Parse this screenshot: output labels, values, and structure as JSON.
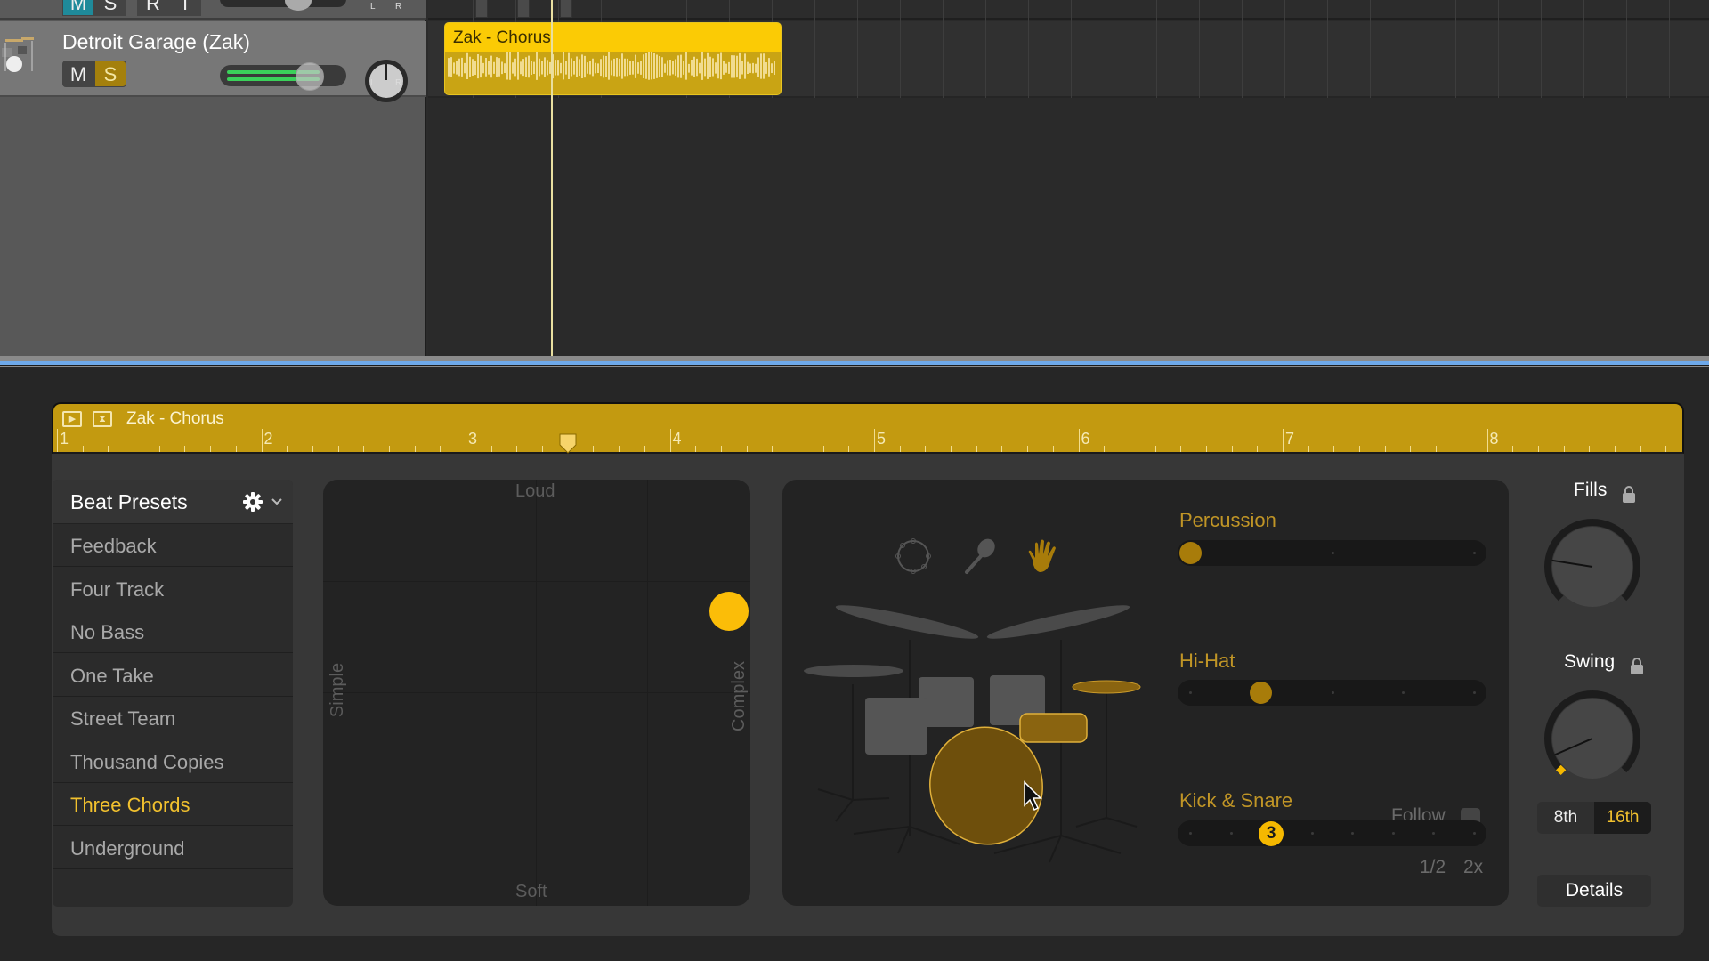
{
  "tracks": {
    "top_track": {
      "mute_label": "M",
      "solo_label": "S",
      "record_label": "R",
      "input_label": "I"
    },
    "track": {
      "name": "Detroit Garage (Zak)",
      "mute_label": "M",
      "solo_label": "S",
      "solo_active": true,
      "volume_fraction": 0.78,
      "pan_left_label": "L",
      "pan_right_label": "R"
    },
    "region": {
      "title": "Zak - Chorus",
      "color": "#fbcb05"
    }
  },
  "editor": {
    "region_title": "Zak - Chorus",
    "ruler_bars": [
      "1",
      "2",
      "3",
      "4",
      "5",
      "6",
      "7",
      "8"
    ],
    "playhead_bar": 3.5,
    "header_color": "#c39a10",
    "beat_presets": {
      "title": "Beat Presets",
      "settings_icon": "gear-icon",
      "items": [
        {
          "label": "Feedback",
          "selected": false
        },
        {
          "label": "Four Track",
          "selected": false
        },
        {
          "label": "No Bass",
          "selected": false
        },
        {
          "label": "One Take",
          "selected": false
        },
        {
          "label": "Street Team",
          "selected": false
        },
        {
          "label": "Thousand Copies",
          "selected": false
        },
        {
          "label": "Three Chords",
          "selected": true
        },
        {
          "label": "Underground",
          "selected": false
        }
      ]
    },
    "xy_pad": {
      "top_label": "Loud",
      "bottom_label": "Soft",
      "left_label": "Simple",
      "right_label": "Complex",
      "complexity": 0.95,
      "loudness": 0.69
    },
    "kit": {
      "percussion_icons": [
        "tambourine-icon",
        "shaker-icon",
        "handclap-icon"
      ],
      "active_percussion": "handclap-icon",
      "percussion": {
        "label": "Percussion",
        "value": 0,
        "steps": 3
      },
      "hihat": {
        "label": "Hi-Hat",
        "value": 1,
        "steps": 5
      },
      "kick_snare": {
        "label": "Kick & Snare",
        "value": 3,
        "value_label": "3",
        "steps": 8
      },
      "follow_label": "Follow",
      "follow_checked": false,
      "half_label": "1/2",
      "double_label": "2x"
    },
    "fills": {
      "label": "Fills",
      "locked": false,
      "value": 0.2
    },
    "swing": {
      "label": "Swing",
      "locked": false,
      "value": 0.08
    },
    "note_division": {
      "options": [
        "8th",
        "16th"
      ],
      "selected": "16th"
    },
    "details_label": "Details",
    "accent_color": "#f5b800"
  }
}
